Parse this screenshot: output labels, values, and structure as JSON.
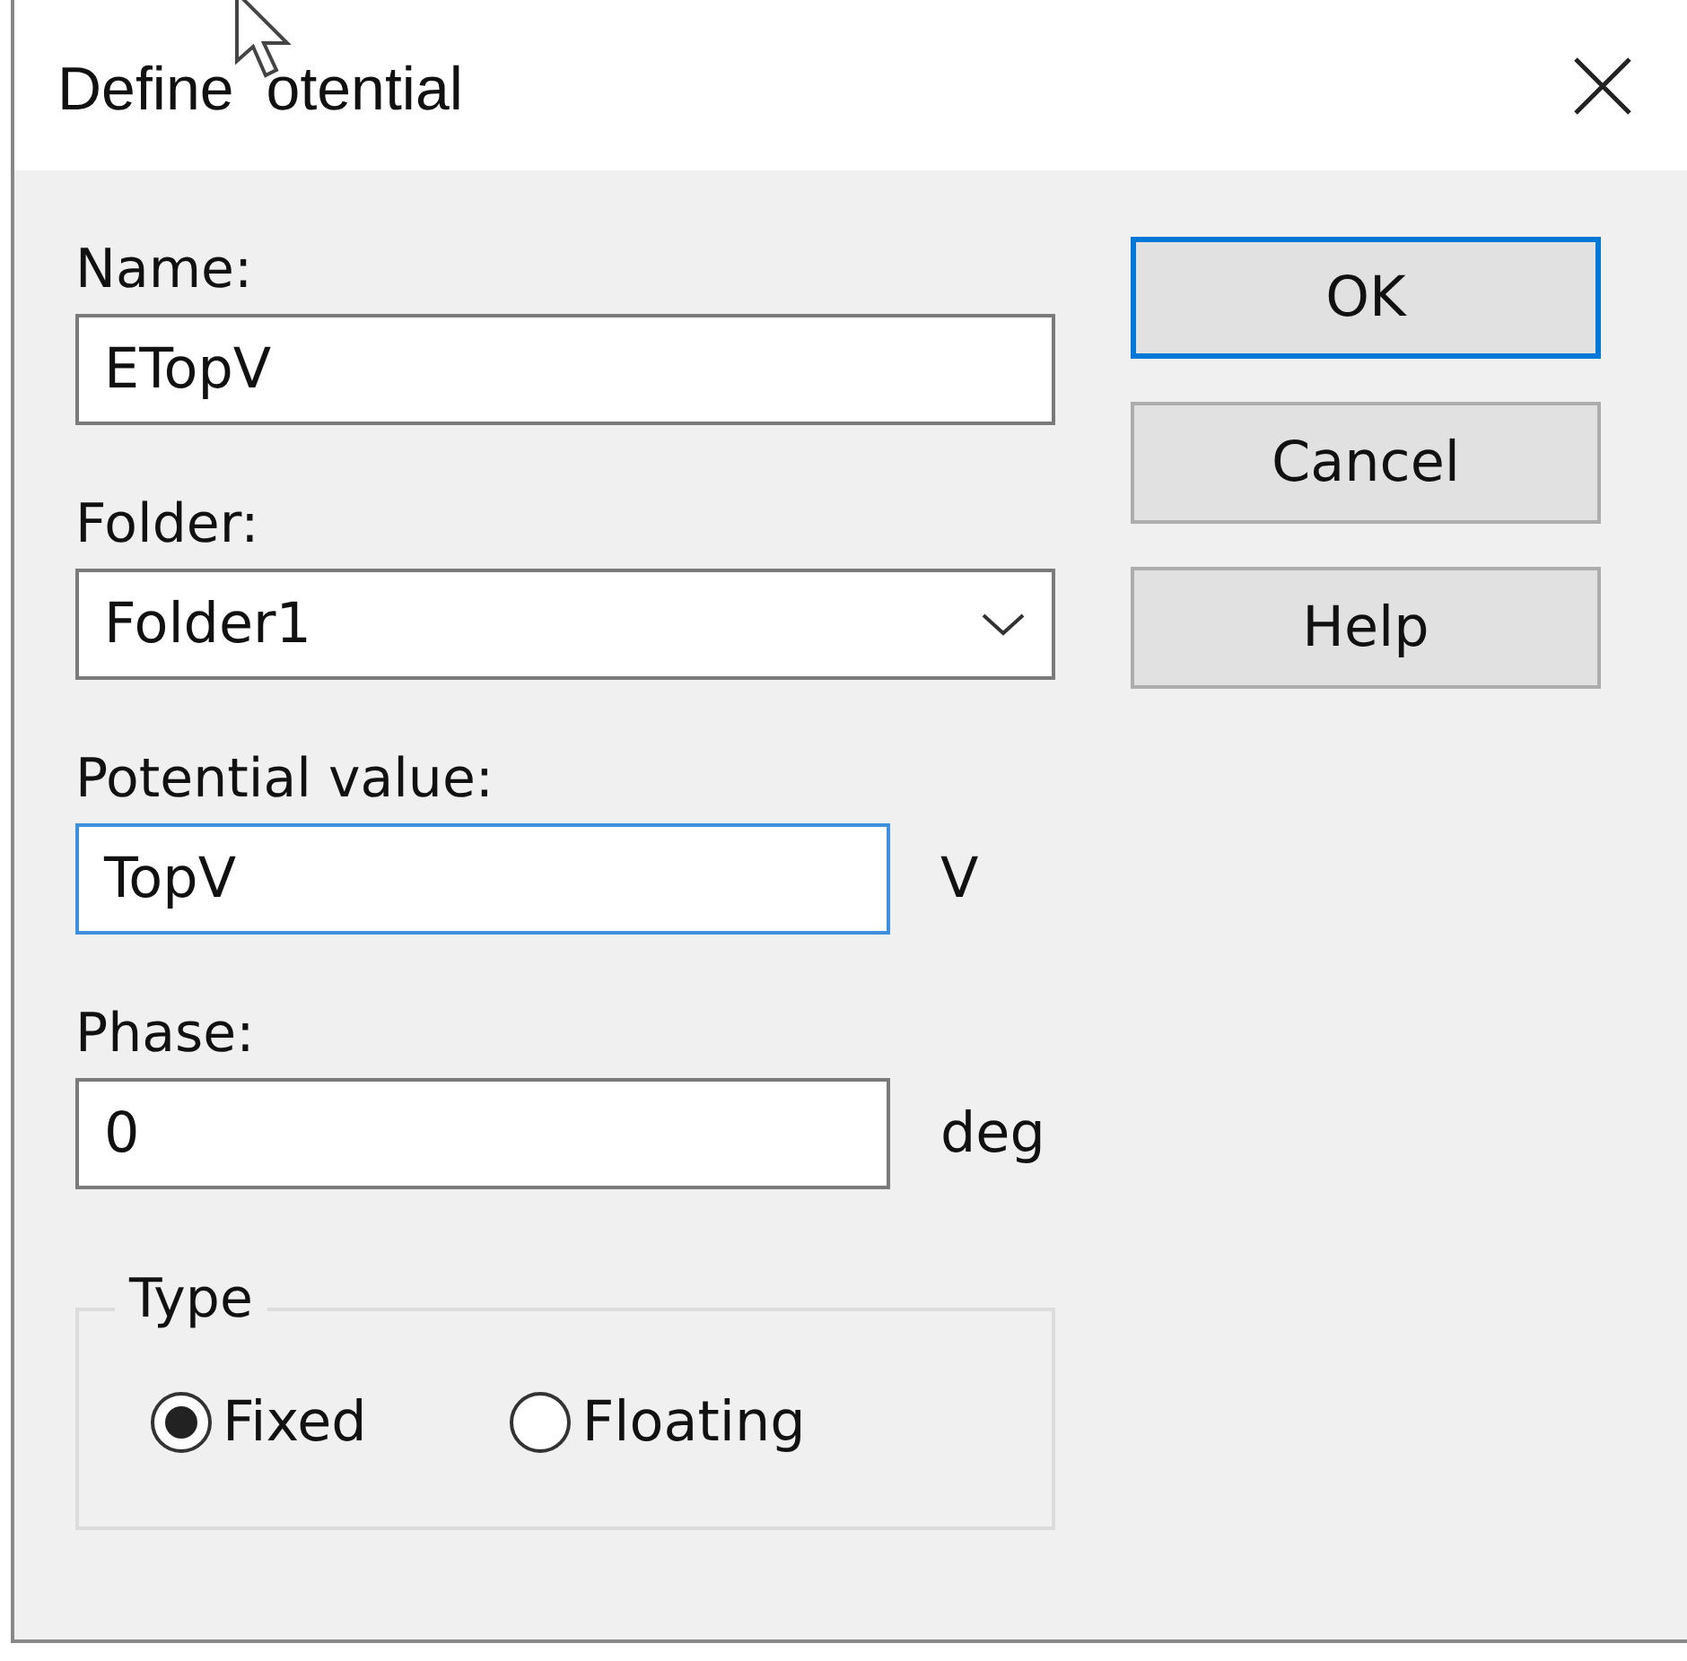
{
  "window": {
    "title_parts": [
      "Define",
      "otential"
    ]
  },
  "fields": [
    {
      "kind": "text",
      "label": "Name:",
      "value": "ETopV",
      "focused": false
    },
    {
      "kind": "dropdown",
      "label": "Folder:",
      "value": "Folder1",
      "focused": false
    },
    {
      "kind": "text",
      "label": "Potential value:",
      "value": "TopV",
      "unit": "V",
      "focused": true
    },
    {
      "kind": "text",
      "label": "Phase:",
      "value": "0",
      "unit": "deg",
      "focused": false
    }
  ],
  "type_group": {
    "label": "Type",
    "options": [
      {
        "label": "Fixed",
        "selected": true
      },
      {
        "label": "Floating",
        "selected": false
      }
    ]
  },
  "buttons": [
    {
      "label": "OK",
      "default": true
    },
    {
      "label": "Cancel",
      "default": false
    },
    {
      "label": "Help",
      "default": false
    }
  ]
}
